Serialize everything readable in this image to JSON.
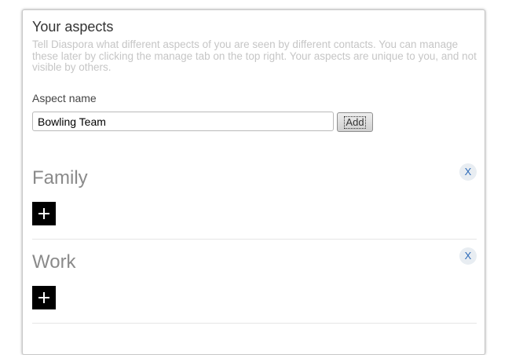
{
  "header": {
    "title": "Your aspects",
    "description": "Tell Diaspora what different aspects of you are seen by different contacts. You can manage these later by clicking the manage tab on the top right. Your aspects are unique to you, and not visible by others."
  },
  "form": {
    "label": "Aspect name",
    "input_value": "Bowling Team",
    "add_label": "Add"
  },
  "aspects": [
    {
      "name": "Family",
      "remove_label": "X",
      "add_icon": "plus-icon"
    },
    {
      "name": "Work",
      "remove_label": "X",
      "add_icon": "plus-icon"
    }
  ]
}
